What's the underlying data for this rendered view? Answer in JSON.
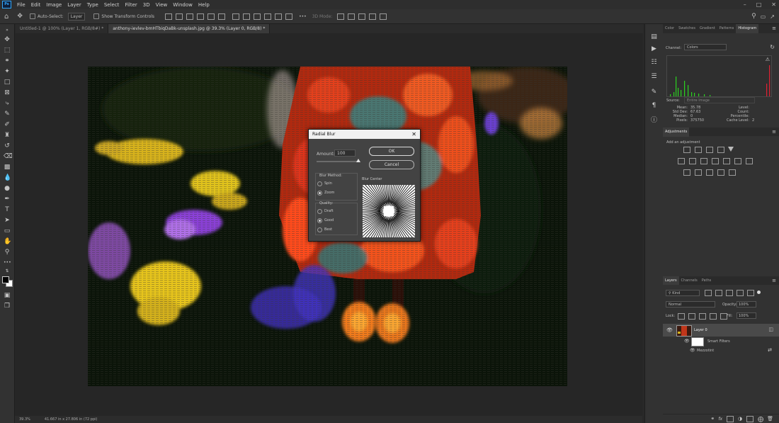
{
  "app": {
    "menu": [
      "File",
      "Edit",
      "Image",
      "Layer",
      "Type",
      "Select",
      "Filter",
      "3D",
      "View",
      "Window",
      "Help"
    ],
    "logo": "Ps"
  },
  "options_bar": {
    "auto_select": "Auto-Select:",
    "layer_select": "Layer",
    "show_transform": "Show Transform Controls",
    "mode_3d": "3D Mode:"
  },
  "tabs": [
    {
      "label": "Untitled-1 @ 100% (Layer 1, RGB/8#) *",
      "active": false
    },
    {
      "label": "anthony-ievlev-bmHTbiqDaBk-unsplash.jpg @ 39.3% (Layer 0, RGB/8) *",
      "active": true
    }
  ],
  "status": {
    "zoom": "39.3%",
    "doc_size": "41.667 in x 27.806 in (72 ppi)"
  },
  "dialog": {
    "title": "Radial Blur",
    "amount_label": "Amount:",
    "amount_value": "100",
    "ok": "OK",
    "cancel": "Cancel",
    "blur_method_label": "Blur Method:",
    "methods": [
      "Spin",
      "Zoom"
    ],
    "selected_method": "Zoom",
    "quality_label": "Quality:",
    "qualities": [
      "Draft",
      "Good",
      "Best"
    ],
    "selected_quality": "Good",
    "blur_center_label": "Blur Center"
  },
  "histogram_panel": {
    "tabs": [
      "Color",
      "Swatches",
      "Gradient",
      "Patterns",
      "Histogram"
    ],
    "active_tab": "Histogram",
    "channel_label": "Channel:",
    "channel_value": "Colors",
    "source_label": "Source:",
    "source_value": "Entire Image",
    "stats_left": [
      {
        "k": "Mean:",
        "v": "35.78"
      },
      {
        "k": "Std Dev:",
        "v": "67.63"
      },
      {
        "k": "Median:",
        "v": "0"
      },
      {
        "k": "Pixels:",
        "v": "375750"
      }
    ],
    "stats_right": [
      {
        "k": "Level:",
        "v": ""
      },
      {
        "k": "Count:",
        "v": ""
      },
      {
        "k": "Percentile:",
        "v": ""
      },
      {
        "k": "Cache Level:",
        "v": "2"
      }
    ]
  },
  "adjustments_panel": {
    "title": "Adjustments",
    "subtitle": "Add an adjustment"
  },
  "layers_panel": {
    "tabs": [
      "Layers",
      "Channels",
      "Paths"
    ],
    "active_tab": "Layers",
    "kind": "Kind",
    "blend_mode": "Normal",
    "opacity_label": "Opacity:",
    "opacity_value": "100%",
    "lock_label": "Lock:",
    "fill_label": "Fill:",
    "fill_value": "100%",
    "layer_name": "Layer 0",
    "smart_filters": "Smart Filters",
    "filter_name": "Mezzotint"
  },
  "colors": {
    "accent": "#31a8ff",
    "panel_bg": "#323232",
    "dialog_bg": "#434343",
    "histogram_bar": "#2bd11f"
  }
}
